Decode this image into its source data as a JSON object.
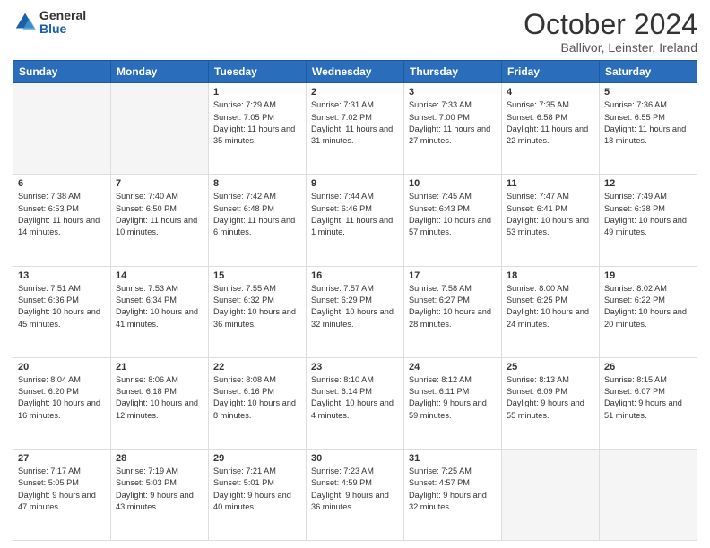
{
  "logo": {
    "general": "General",
    "blue": "Blue"
  },
  "title": {
    "month": "October 2024",
    "location": "Ballivor, Leinster, Ireland"
  },
  "weekdays": [
    "Sunday",
    "Monday",
    "Tuesday",
    "Wednesday",
    "Thursday",
    "Friday",
    "Saturday"
  ],
  "weeks": [
    [
      {
        "day": "",
        "empty": true
      },
      {
        "day": "",
        "empty": true
      },
      {
        "day": "1",
        "sunrise": "7:29 AM",
        "sunset": "7:05 PM",
        "daylight": "11 hours and 35 minutes."
      },
      {
        "day": "2",
        "sunrise": "7:31 AM",
        "sunset": "7:02 PM",
        "daylight": "11 hours and 31 minutes."
      },
      {
        "day": "3",
        "sunrise": "7:33 AM",
        "sunset": "7:00 PM",
        "daylight": "11 hours and 27 minutes."
      },
      {
        "day": "4",
        "sunrise": "7:35 AM",
        "sunset": "6:58 PM",
        "daylight": "11 hours and 22 minutes."
      },
      {
        "day": "5",
        "sunrise": "7:36 AM",
        "sunset": "6:55 PM",
        "daylight": "11 hours and 18 minutes."
      }
    ],
    [
      {
        "day": "6",
        "sunrise": "7:38 AM",
        "sunset": "6:53 PM",
        "daylight": "11 hours and 14 minutes."
      },
      {
        "day": "7",
        "sunrise": "7:40 AM",
        "sunset": "6:50 PM",
        "daylight": "11 hours and 10 minutes."
      },
      {
        "day": "8",
        "sunrise": "7:42 AM",
        "sunset": "6:48 PM",
        "daylight": "11 hours and 6 minutes."
      },
      {
        "day": "9",
        "sunrise": "7:44 AM",
        "sunset": "6:46 PM",
        "daylight": "11 hours and 1 minute."
      },
      {
        "day": "10",
        "sunrise": "7:45 AM",
        "sunset": "6:43 PM",
        "daylight": "10 hours and 57 minutes."
      },
      {
        "day": "11",
        "sunrise": "7:47 AM",
        "sunset": "6:41 PM",
        "daylight": "10 hours and 53 minutes."
      },
      {
        "day": "12",
        "sunrise": "7:49 AM",
        "sunset": "6:38 PM",
        "daylight": "10 hours and 49 minutes."
      }
    ],
    [
      {
        "day": "13",
        "sunrise": "7:51 AM",
        "sunset": "6:36 PM",
        "daylight": "10 hours and 45 minutes."
      },
      {
        "day": "14",
        "sunrise": "7:53 AM",
        "sunset": "6:34 PM",
        "daylight": "10 hours and 41 minutes."
      },
      {
        "day": "15",
        "sunrise": "7:55 AM",
        "sunset": "6:32 PM",
        "daylight": "10 hours and 36 minutes."
      },
      {
        "day": "16",
        "sunrise": "7:57 AM",
        "sunset": "6:29 PM",
        "daylight": "10 hours and 32 minutes."
      },
      {
        "day": "17",
        "sunrise": "7:58 AM",
        "sunset": "6:27 PM",
        "daylight": "10 hours and 28 minutes."
      },
      {
        "day": "18",
        "sunrise": "8:00 AM",
        "sunset": "6:25 PM",
        "daylight": "10 hours and 24 minutes."
      },
      {
        "day": "19",
        "sunrise": "8:02 AM",
        "sunset": "6:22 PM",
        "daylight": "10 hours and 20 minutes."
      }
    ],
    [
      {
        "day": "20",
        "sunrise": "8:04 AM",
        "sunset": "6:20 PM",
        "daylight": "10 hours and 16 minutes."
      },
      {
        "day": "21",
        "sunrise": "8:06 AM",
        "sunset": "6:18 PM",
        "daylight": "10 hours and 12 minutes."
      },
      {
        "day": "22",
        "sunrise": "8:08 AM",
        "sunset": "6:16 PM",
        "daylight": "10 hours and 8 minutes."
      },
      {
        "day": "23",
        "sunrise": "8:10 AM",
        "sunset": "6:14 PM",
        "daylight": "10 hours and 4 minutes."
      },
      {
        "day": "24",
        "sunrise": "8:12 AM",
        "sunset": "6:11 PM",
        "daylight": "9 hours and 59 minutes."
      },
      {
        "day": "25",
        "sunrise": "8:13 AM",
        "sunset": "6:09 PM",
        "daylight": "9 hours and 55 minutes."
      },
      {
        "day": "26",
        "sunrise": "8:15 AM",
        "sunset": "6:07 PM",
        "daylight": "9 hours and 51 minutes."
      }
    ],
    [
      {
        "day": "27",
        "sunrise": "7:17 AM",
        "sunset": "5:05 PM",
        "daylight": "9 hours and 47 minutes."
      },
      {
        "day": "28",
        "sunrise": "7:19 AM",
        "sunset": "5:03 PM",
        "daylight": "9 hours and 43 minutes."
      },
      {
        "day": "29",
        "sunrise": "7:21 AM",
        "sunset": "5:01 PM",
        "daylight": "9 hours and 40 minutes."
      },
      {
        "day": "30",
        "sunrise": "7:23 AM",
        "sunset": "4:59 PM",
        "daylight": "9 hours and 36 minutes."
      },
      {
        "day": "31",
        "sunrise": "7:25 AM",
        "sunset": "4:57 PM",
        "daylight": "9 hours and 32 minutes."
      },
      {
        "day": "",
        "empty": true
      },
      {
        "day": "",
        "empty": true
      }
    ]
  ]
}
